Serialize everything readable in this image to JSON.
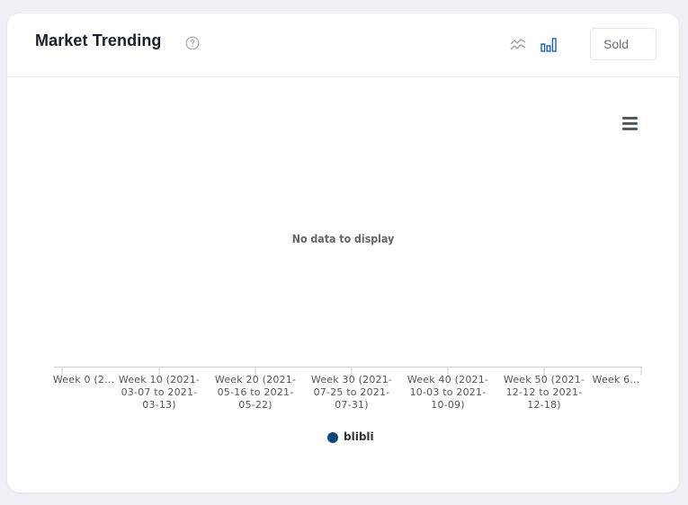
{
  "header": {
    "title": "Market Trending",
    "help_icon": "question-circle-icon",
    "line_chart_icon": "line-chart-icon",
    "bar_chart_icon": "bar-chart-icon",
    "metric_selected": "Sold"
  },
  "chart": {
    "menu_icon": "hamburger-menu-icon",
    "empty_message": "No data to display",
    "legend_label": "blibli",
    "legend_color": "#0b4a7e",
    "active_toggle_color": "#1565c0",
    "inactive_toggle_color": "#9aa0ad"
  },
  "chart_data": {
    "type": "bar",
    "categories": [
      "Week 0 (2...",
      "Week 10 (2021-03-07 to 2021-03-13)",
      "Week 20 (2021-05-16 to 2021-05-22)",
      "Week 30 (2021-07-25 to 2021-07-31)",
      "Week 40 (2021-10-03 to 2021-10-09)",
      "Week 50 (2021-12-12 to 2021-12-18)",
      "Week 6..."
    ],
    "series": [
      {
        "name": "blibli",
        "values": []
      }
    ],
    "xlabel": "",
    "ylabel": "",
    "legend_position": "bottom-center",
    "grid": false
  }
}
